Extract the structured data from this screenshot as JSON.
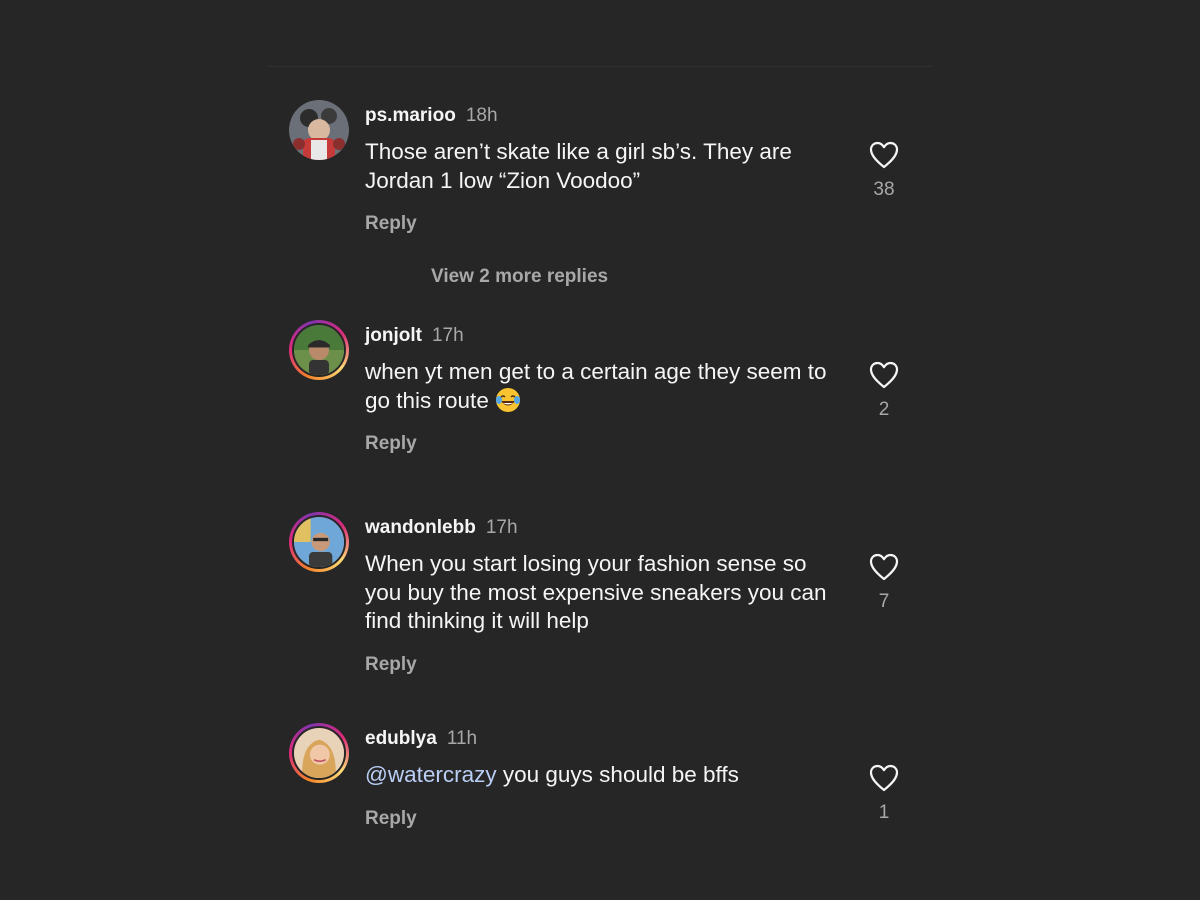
{
  "comments": [
    {
      "username": "ps.marioo",
      "time": "18h",
      "text": "Those aren’t skate like a girl sb’s. They are Jordan 1 low “Zion Voodoo”",
      "reply_label": "Reply",
      "likes": "38"
    },
    {
      "username": "jonjolt",
      "time": "17h",
      "text": "when yt men get to a certain age they seem to go this route",
      "emoji": "face-with-tears-of-joy",
      "reply_label": "Reply",
      "likes": "2"
    },
    {
      "username": "wandonlebb",
      "time": "17h",
      "text": "When you start losing your fashion sense so you buy the most expensive sneakers you can find thinking it will help",
      "reply_label": "Reply",
      "likes": "7"
    },
    {
      "username": "edublya",
      "time": "11h",
      "mention": "@watercrazy",
      "text": " you guys should be bffs",
      "reply_label": "Reply",
      "likes": "1"
    }
  ],
  "view_more_replies": "View 2 more replies",
  "icons": {
    "like": "heart-outline-icon"
  },
  "colors": {
    "background": "#262626",
    "primary_text": "#f5f5f5",
    "secondary_text": "#a8a8a8",
    "mention": "#b9cdf5"
  }
}
